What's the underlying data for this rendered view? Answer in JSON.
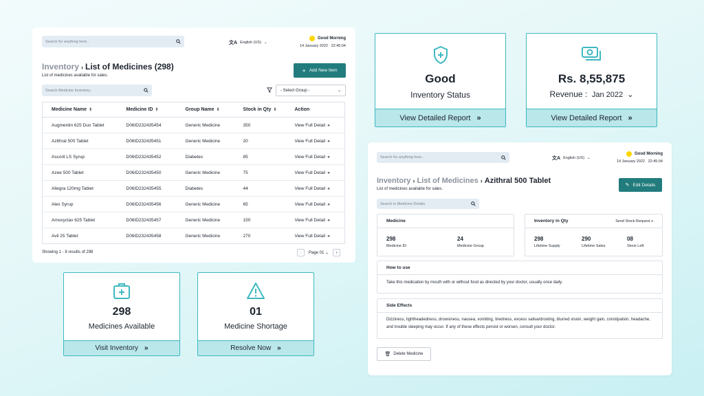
{
  "search": {
    "placeholder": "Search for anything here.."
  },
  "language": "English (US)",
  "greeting": {
    "text": "Good Morning",
    "date": "14 January 2022",
    "time": "22:45:04"
  },
  "inventory_list": {
    "breadcrumb": "Inventory",
    "title": "List of Medicines (298)",
    "subtitle": "List of medicines available for sales.",
    "add_button": "Add New Item",
    "search_placeholder": "Search Medicine Inventory..",
    "group_select": "- Select Group -",
    "columns": [
      "Medicine Name",
      "Medicine ID",
      "Group Name",
      "Stock in Qty",
      "Action"
    ],
    "action_label": "View Full Detail",
    "rows": [
      {
        "name": "Augmentin 625 Duo Tablet",
        "id": "D06ID232435454",
        "group": "Generic Medicine",
        "stock": "350"
      },
      {
        "name": "Azithral 500 Tablet",
        "id": "D06ID232435451",
        "group": "Generic Medicine",
        "stock": "20"
      },
      {
        "name": "Ascoril LS Syrup",
        "id": "D06ID232435452",
        "group": "Diabetes",
        "stock": "85"
      },
      {
        "name": "Azee 500 Tablet",
        "id": "D06ID232435450",
        "group": "Generic Medicine",
        "stock": "75"
      },
      {
        "name": "Allegra 120mg Tablet",
        "id": "D06ID232435455",
        "group": "Diabetes",
        "stock": "44"
      },
      {
        "name": "Alex Syrup",
        "id": "D06ID232435456",
        "group": "Generic Medicine",
        "stock": "65"
      },
      {
        "name": "Amoxyclav 625 Tablet",
        "id": "D06ID232435457",
        "group": "Generic Medicine",
        "stock": "150"
      },
      {
        "name": "Avil 25 Tablet",
        "id": "D06ID232435458",
        "group": "Generic Medicine",
        "stock": "270"
      }
    ],
    "showing": "Showing 1 - 8 results of 298",
    "page": "Page 01"
  },
  "cards": {
    "status": {
      "value": "Good",
      "label": "Inventory Status",
      "footer": "View Detailed Report",
      "accent": "#3db8c0"
    },
    "revenue": {
      "value": "Rs. 8,55,875",
      "label": "Revenue :",
      "period": "Jan 2022",
      "footer": "View Detailed Report",
      "accent": "#3db8c0"
    },
    "available": {
      "value": "298",
      "label": "Medicines Available",
      "footer": "Visit Inventory",
      "accent": "#3db8c0"
    },
    "shortage": {
      "value": "01",
      "label": "Medicine Shortage",
      "footer": "Resolve Now",
      "accent": "#3db8c0"
    }
  },
  "detail": {
    "breadcrumb1": "Inventory",
    "breadcrumb2": "List of Medicines",
    "title": "Azithral 500 Tablet",
    "subtitle": "List of medicines available for sales.",
    "edit_button": "Edit Details",
    "search_placeholder": "Search in Medicine Details",
    "medicine": {
      "header": "Medicine",
      "id_value": "298",
      "id_label": "Medicine ID",
      "group_value": "24",
      "group_label": "Medicine Group"
    },
    "inventory": {
      "header": "Inventory in Qty",
      "link": "Send Stock Request",
      "supply_value": "298",
      "supply_label": "Lifetime Supply",
      "sales_value": "290",
      "sales_label": "Lifetime Sales",
      "stock_value": "08",
      "stock_label": "Stock Left"
    },
    "how_to_use": {
      "header": "How to use",
      "text": "Take this medication by mouth with or without food as directed by your doctor, usually once daily."
    },
    "side_effects": {
      "header": "Side Effects",
      "text": "Dizziness, lightheadedness, drowsiness, nausea, vomiting, tiredness, excess saliva/drooling, blurred vision, weight gain, constipation, headache, and trouble sleeping may occur. If any of these effects persist or worsen, consult your doctor."
    },
    "delete_button": "Delete Medicine"
  },
  "colors": {
    "primary": "#227c7d",
    "accent": "#3db8c0",
    "footer_bg": "#b9e7ea",
    "sun": "#fed600"
  }
}
